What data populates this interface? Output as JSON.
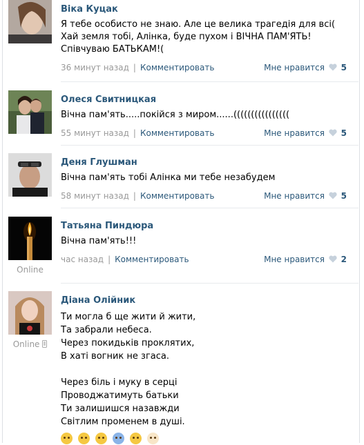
{
  "comments": [
    {
      "author": "Віка Куцак",
      "text": "Я тебе особисто не знаю. Але це велика трагедія для всі( Хай земля тобі, Алінка, буде пухом і ВІЧНА ПАМ'ЯТЬ!Співчуваю БАТЬКАМ!(",
      "time": "36 минут назад",
      "reply_label": "Комментировать",
      "like_label": "Мне нравится",
      "likes": "5"
    },
    {
      "author": "Олеся Свитницкая",
      "text": "Вічна пам'ять.....покійся з миром......((((((((((((((((",
      "time": "55 минут назад",
      "reply_label": "Комментировать",
      "like_label": "Мне нравится",
      "likes": "5"
    },
    {
      "author": "Деня Глушман",
      "text": "Вічна пам'ять тобі Алінка ми тебе незабудем",
      "time": "58 минут назад",
      "reply_label": "Комментировать",
      "like_label": "Мне нравится",
      "likes": "5"
    },
    {
      "author": "Татьяна Пиндюра",
      "text": "Вічна пам'ять!!!",
      "time": "час назад",
      "reply_label": "Комментировать",
      "like_label": "Мне нравится",
      "likes": "2",
      "status": "Online"
    },
    {
      "author": "Діана Олійник",
      "status": "Online",
      "poem": [
        "Ти могла б ще жити й жити,",
        "Та забрали небеса.",
        "Через покидьків проклятих,",
        "В хаті вогник не згаса.",
        "",
        "Через біль і муку в серці",
        "Проводжатимуть батьки",
        "Ти залишишся назавжди",
        "Світлим променем в душі."
      ]
    }
  ],
  "colors": {
    "link": "#2b587a",
    "meta": "#999999",
    "heart": "#c6d1dc"
  }
}
